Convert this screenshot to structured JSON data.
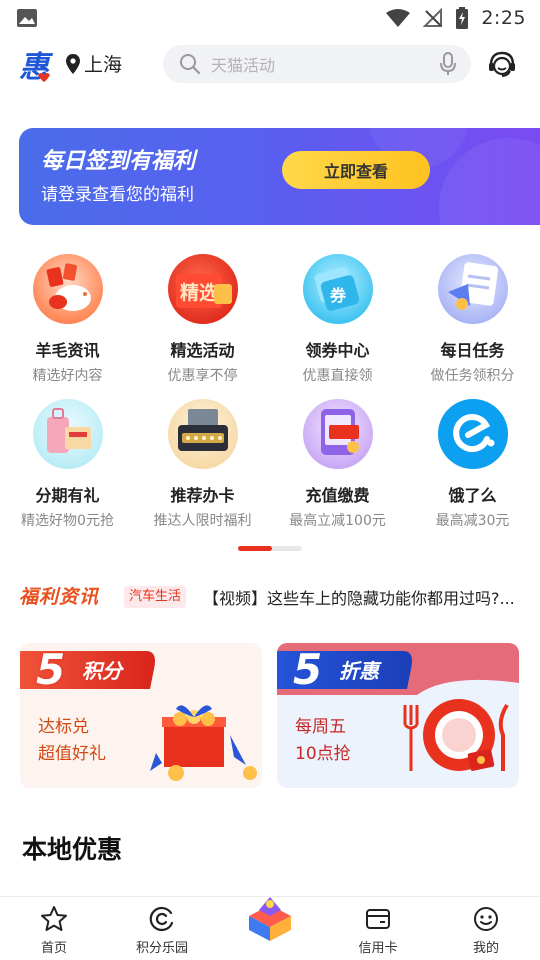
{
  "status_bar": {
    "time": "2:25"
  },
  "header": {
    "location": "上海",
    "search_placeholder": "天猫活动"
  },
  "banner": {
    "title": "每日签到有福利",
    "subtitle": "请登录查看您的福利",
    "button_label": "立即查看"
  },
  "grid": {
    "items": [
      {
        "title": "羊毛资讯",
        "subtitle": "精选好内容",
        "icon": "piggy-bank-icon"
      },
      {
        "title": "精选活动",
        "subtitle": "优惠享不停",
        "icon": "featured-activity-icon",
        "icon_text": "精选"
      },
      {
        "title": "领券中心",
        "subtitle": "优惠直接领",
        "icon": "coupon-icon",
        "icon_text": "券"
      },
      {
        "title": "每日任务",
        "subtitle": "做任务领积分",
        "icon": "task-icon"
      },
      {
        "title": "分期有礼",
        "subtitle": "精选好物0元抢",
        "icon": "luggage-icon"
      },
      {
        "title": "推荐办卡",
        "subtitle": "推达人限时福利",
        "icon": "gold-card-icon"
      },
      {
        "title": "充值缴费",
        "subtitle": "最高立减100元",
        "icon": "recharge-icon"
      },
      {
        "title": "饿了么",
        "subtitle": "最高减30元",
        "icon": "eleme-icon"
      }
    ]
  },
  "news": {
    "brand": "福利资讯",
    "tag": "汽车生活",
    "headline": "【视频】这些车上的隐藏功能你都用过吗?..."
  },
  "promos": [
    {
      "badge_number": "5",
      "badge_label": "积分",
      "line1": "达标兑",
      "line2": "超值好礼"
    },
    {
      "badge_number": "5",
      "badge_label": "折惠",
      "line1": "每周五",
      "line2": "10点抢"
    }
  ],
  "section": {
    "title": "本地优惠"
  },
  "bottom_nav": {
    "items": [
      {
        "label": "首页",
        "icon": "star-home-icon"
      },
      {
        "label": "积分乐园",
        "icon": "points-icon"
      },
      {
        "label": "",
        "icon": "center-gift-icon"
      },
      {
        "label": "信用卡",
        "icon": "credit-card-icon"
      },
      {
        "label": "我的",
        "icon": "profile-icon"
      }
    ]
  },
  "colors": {
    "accent_red": "#e8321e",
    "banner_blue": "#4a6dea",
    "button_yellow": "#ffc220"
  }
}
